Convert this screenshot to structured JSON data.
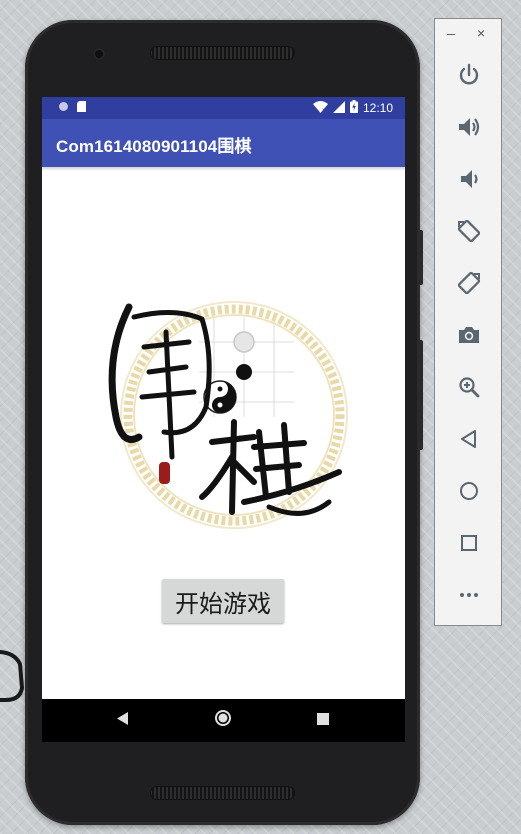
{
  "status_bar": {
    "time": "12:10"
  },
  "app_bar": {
    "title": "Com1614080901104围棋"
  },
  "main": {
    "logo_icon": "weiqi-calligraphy-logo",
    "start_button_label": "开始游戏"
  },
  "nav_bar": {
    "back_icon": "back-triangle-icon",
    "home_icon": "home-circle-icon",
    "recents_icon": "recents-square-icon"
  },
  "emulator_toolbar": {
    "minimize_label": "–",
    "close_label": "×",
    "buttons": [
      "power-icon",
      "volume-up-icon",
      "volume-down-icon",
      "rotate-left-icon",
      "rotate-right-icon",
      "camera-icon",
      "zoom-icon",
      "back-icon",
      "home-icon",
      "overview-icon",
      "more-icon"
    ]
  },
  "colors": {
    "status_bar": "#303f9f",
    "app_bar": "#3f51b5",
    "toolbar_icon": "#5a6670",
    "phone_body": "#1f1f21"
  }
}
